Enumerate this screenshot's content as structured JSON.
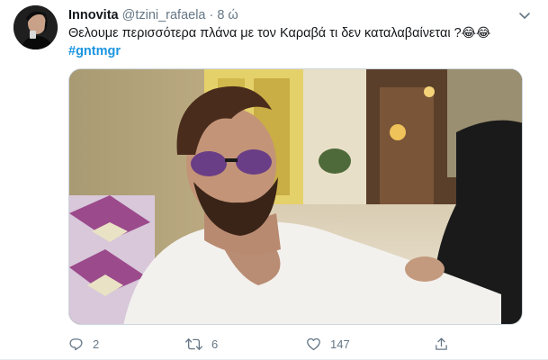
{
  "tweet": {
    "display_name": "Innovita",
    "handle": "@tzini_rafaela",
    "separator": "·",
    "time": "8 ώ",
    "text": "Θελουμε περισσότερα πλάνα με τον Καραβά τι δεν καταλαβαίνεται ?",
    "emoji": "😂😂",
    "hashtag": "#gntmgr",
    "media_alt": "Photo of a man with sunglasses lounging on a patterned pillow"
  },
  "actions": {
    "reply_count": "2",
    "retweet_count": "6",
    "like_count": "147"
  },
  "icons": {
    "more": "chevron-down-icon",
    "reply": "reply-icon",
    "retweet": "retweet-icon",
    "like": "heart-icon",
    "share": "share-icon"
  },
  "colors": {
    "text": "#14171a",
    "secondary": "#657786",
    "link": "#1b95e0",
    "border": "#e6ecf0"
  }
}
